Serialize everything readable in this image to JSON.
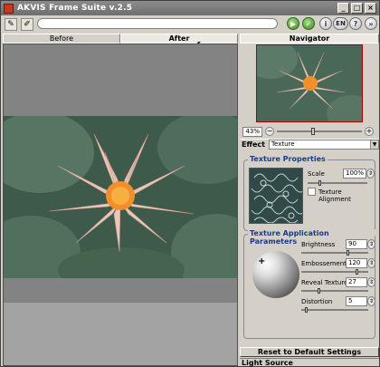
{
  "window": {
    "title": "AKVIS Frame Suite v.2.5",
    "min": "_",
    "max": "□",
    "close": "×"
  },
  "toolbar": {
    "open_icon": "✎",
    "brush_icon": "✐",
    "lang": "EN",
    "info": "i",
    "help": "?",
    "more": "»",
    "play": "▶",
    "ok": "✓"
  },
  "tabs": {
    "before": "Before",
    "after": "After"
  },
  "navigator": {
    "title": "Navigator",
    "zoom": "43%",
    "zoom_level": 0.43
  },
  "effect": {
    "label": "Effect",
    "value": "Texture"
  },
  "texture_properties": {
    "title": "Texture Properties",
    "scale_label": "Scale",
    "scale_value": "100%",
    "alignment_label": "Texture Alignment"
  },
  "texture_application": {
    "title": "Texture Application Parameters",
    "brightness_label": "Brightness",
    "brightness_value": "90",
    "embossment_label": "Embossement",
    "embossment_value": "120",
    "reveal_label": "Reveal Texture",
    "reveal_value": "27",
    "distortion_label": "Distortion",
    "distortion_value": "5"
  },
  "buttons": {
    "reset": "Reset to Default Settings"
  },
  "footer": {
    "light_source": "Light Source"
  },
  "colors": {
    "title_bar": "#7c7c7c",
    "group_title": "#1c3a8a",
    "canvas": "#838383"
  }
}
